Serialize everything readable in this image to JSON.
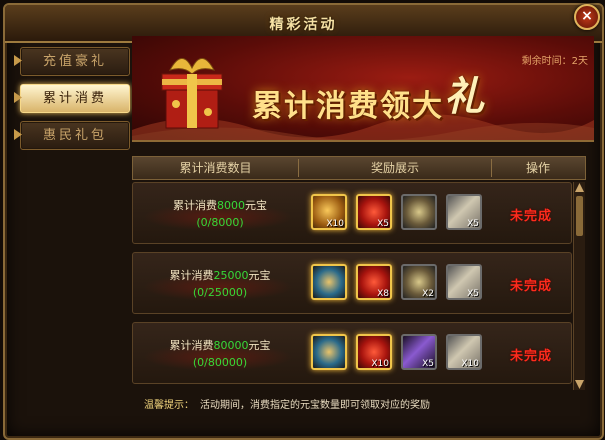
{
  "window": {
    "title": "精彩活动",
    "close_label": "×"
  },
  "side_tabs": [
    {
      "label": "充值豪礼",
      "active": false
    },
    {
      "label": "累计消费",
      "active": true
    },
    {
      "label": "惠民礼包",
      "active": false
    }
  ],
  "banner": {
    "title_main": "累计消费领大",
    "title_big": "礼",
    "remaining": "剩余时间：2天"
  },
  "table": {
    "headers": [
      "累计消费数目",
      "奖励展示",
      "操作"
    ],
    "rows": [
      {
        "cond_prefix": "累计消费",
        "cond_amount": "8000",
        "cond_suffix": "元宝",
        "progress": "(0/8000)",
        "status": "未完成",
        "rewards": [
          {
            "name": "gold-coin-icon",
            "qty": "X10",
            "style": "gold"
          },
          {
            "name": "red-gem-icon",
            "qty": "X5",
            "style": "gold"
          },
          {
            "name": "horned-orb-icon",
            "qty": "",
            "style": "plain"
          },
          {
            "name": "scroll-icon",
            "qty": "X5",
            "style": "plain"
          }
        ]
      },
      {
        "cond_prefix": "累计消费",
        "cond_amount": "25000",
        "cond_suffix": "元宝",
        "progress": "(0/25000)",
        "status": "未完成",
        "rewards": [
          {
            "name": "ornate-token-icon",
            "qty": "",
            "style": "gold"
          },
          {
            "name": "red-gem-icon",
            "qty": "X8",
            "style": "gold"
          },
          {
            "name": "horned-orb-icon",
            "qty": "X2",
            "style": "plain"
          },
          {
            "name": "scroll-icon",
            "qty": "X5",
            "style": "plain"
          }
        ]
      },
      {
        "cond_prefix": "累计消费",
        "cond_amount": "80000",
        "cond_suffix": "元宝",
        "progress": "(0/80000)",
        "status": "未完成",
        "rewards": [
          {
            "name": "ornate-token-icon",
            "qty": "",
            "style": "gold"
          },
          {
            "name": "red-gem-icon",
            "qty": "X10",
            "style": "gold"
          },
          {
            "name": "purple-blade-icon",
            "qty": "X5",
            "style": "plain"
          },
          {
            "name": "scroll-icon",
            "qty": "X10",
            "style": "plain"
          }
        ]
      }
    ]
  },
  "tip": {
    "label": "温馨提示：",
    "text": "活动期间，消费指定的元宝数量即可领取对应的奖励"
  }
}
